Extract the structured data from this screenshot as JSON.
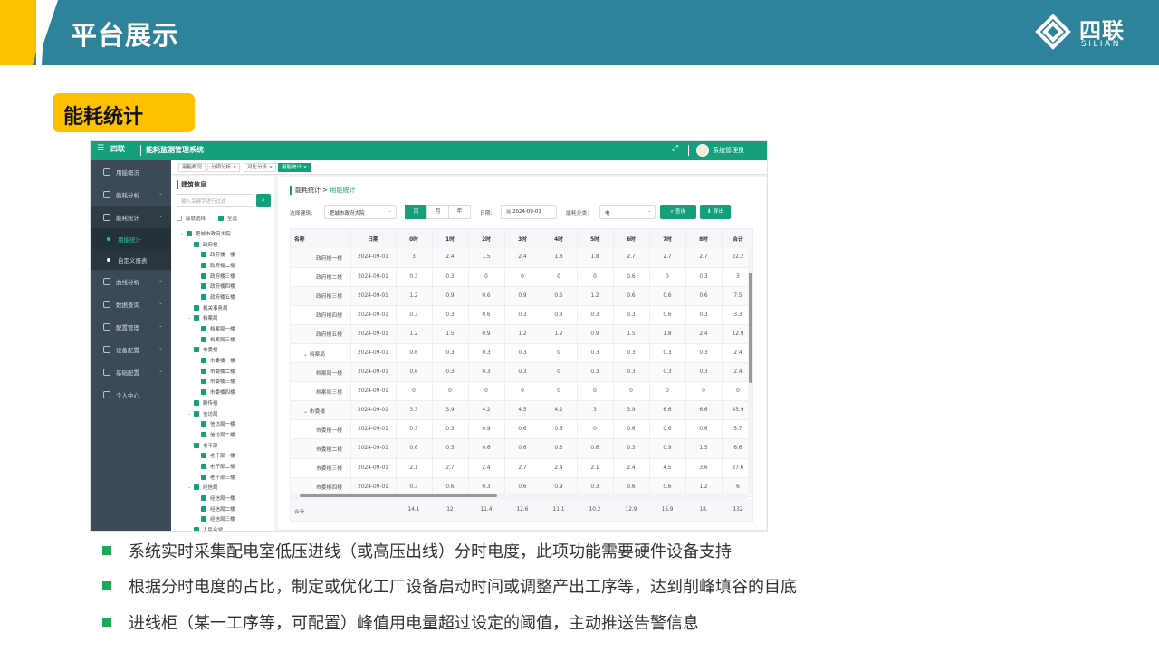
{
  "header": {
    "title": "平台展示",
    "logo_cn": "四联",
    "logo_en": "SILIAN"
  },
  "section_tag": "能耗统计",
  "app": {
    "brand": "四联",
    "system_title": "能耗监测管理系统",
    "user": "系统管理员",
    "sidebar": [
      {
        "label": "用能概况"
      },
      {
        "label": "能耗分析"
      },
      {
        "label": "能耗统计"
      },
      {
        "label": "用能统计",
        "sub": true,
        "active": true
      },
      {
        "label": "自定义报表",
        "sub": true
      },
      {
        "label": "曲线分析"
      },
      {
        "label": "数据查询"
      },
      {
        "label": "配置管理"
      },
      {
        "label": "设备配置"
      },
      {
        "label": "基础配置"
      },
      {
        "label": "个人中心"
      }
    ],
    "tabs": [
      "用能概况",
      "分项分析",
      "对比分析",
      "用能统计"
    ],
    "tree": {
      "title": "建筑信息",
      "search_placeholder": "输入关键字进行过滤",
      "cascade_label": "级联选择",
      "select_all_label": "全选",
      "nodes": [
        {
          "label": "肥城市政府大院",
          "level": 0,
          "arrow": "⌄"
        },
        {
          "label": "政府楼",
          "level": 1,
          "arrow": "⌄"
        },
        {
          "label": "政府楼一楼",
          "level": 2
        },
        {
          "label": "政府楼二楼",
          "level": 2
        },
        {
          "label": "政府楼三楼",
          "level": 2
        },
        {
          "label": "政府楼四楼",
          "level": 2
        },
        {
          "label": "政府楼五楼",
          "level": 2
        },
        {
          "label": "机关事务局",
          "level": 1
        },
        {
          "label": "档案局",
          "level": 1,
          "arrow": "⌄"
        },
        {
          "label": "档案局一楼",
          "level": 2
        },
        {
          "label": "档案局三楼",
          "level": 2
        },
        {
          "label": "市委楼",
          "level": 1,
          "arrow": "⌄"
        },
        {
          "label": "市委楼一楼",
          "level": 2
        },
        {
          "label": "市委楼二楼",
          "level": 2
        },
        {
          "label": "市委楼三楼",
          "level": 2
        },
        {
          "label": "市委楼四楼",
          "level": 2
        },
        {
          "label": "群传楼",
          "level": 1
        },
        {
          "label": "信访局",
          "level": 1,
          "arrow": "⌄"
        },
        {
          "label": "信访局一楼",
          "level": 2
        },
        {
          "label": "信访局二楼",
          "level": 2
        },
        {
          "label": "老干部",
          "level": 1,
          "arrow": "⌄"
        },
        {
          "label": "老干部一楼",
          "level": 2
        },
        {
          "label": "老干部二楼",
          "level": 2
        },
        {
          "label": "老干部三楼",
          "level": 2
        },
        {
          "label": "经信局",
          "level": 1,
          "arrow": "⌄"
        },
        {
          "label": "经信局一楼",
          "level": 2
        },
        {
          "label": "经信局二楼",
          "level": 2
        },
        {
          "label": "经信局三楼",
          "level": 2
        },
        {
          "label": "人民会堂",
          "level": 1
        }
      ]
    },
    "breadcrumb": {
      "parent": "能耗统计",
      "sep": ">",
      "current": "用能统计"
    },
    "filters": {
      "building_label": "选择建筑:",
      "building_value": "肥城市政府大院",
      "periods": [
        "日",
        "月",
        "年"
      ],
      "date_label": "日期:",
      "date_value": "2024-09-01",
      "type_label": "能耗分类:",
      "type_value": "电",
      "query_label": "查询",
      "export_label": "导出"
    },
    "table": {
      "headers": [
        "名称",
        "日期",
        "0时",
        "1时",
        "2时",
        "3时",
        "4时",
        "5时",
        "6时",
        "7时",
        "8时",
        "合计"
      ],
      "rows": [
        [
          "政府楼一楼",
          "2024-09-01",
          "3",
          "2.4",
          "1.5",
          "2.4",
          "1.8",
          "1.8",
          "2.7",
          "2.7",
          "2.7",
          "22.2"
        ],
        [
          "政府楼二楼",
          "2024-09-01",
          "0.3",
          "0.3",
          "0",
          "0",
          "0",
          "0",
          "0.6",
          "0",
          "0.3",
          "3"
        ],
        [
          "政府楼三楼",
          "2024-09-01",
          "1.2",
          "0.9",
          "0.6",
          "0.9",
          "0.6",
          "1.2",
          "0.6",
          "0.6",
          "0.6",
          "7.5"
        ],
        [
          "政府楼四楼",
          "2024-09-01",
          "0.3",
          "0.3",
          "0.6",
          "0.3",
          "0.3",
          "0.3",
          "0.3",
          "0.6",
          "0.3",
          "3.3"
        ],
        [
          "政府楼五楼",
          "2024-09-01",
          "1.2",
          "1.5",
          "0.9",
          "1.2",
          "1.2",
          "0.9",
          "1.5",
          "1.8",
          "2.4",
          "12.9"
        ],
        [
          "档案局",
          "2024-09-01",
          "0.6",
          "0.3",
          "0.3",
          "0.3",
          "0",
          "0.3",
          "0.3",
          "0.3",
          "0.3",
          "2.4"
        ],
        [
          "档案局一楼",
          "2024-09-01",
          "0.6",
          "0.3",
          "0.3",
          "0.3",
          "0",
          "0.3",
          "0.3",
          "0.3",
          "0.3",
          "2.4"
        ],
        [
          "档案局三楼",
          "2024-09-01",
          "0",
          "0",
          "0",
          "0",
          "0",
          "0",
          "0",
          "0",
          "0",
          "0"
        ],
        [
          "市委楼",
          "2024-09-01",
          "3.3",
          "3.9",
          "4.2",
          "4.5",
          "4.2",
          "3",
          "3.9",
          "6.6",
          "6.6",
          "45.9"
        ],
        [
          "市委楼一楼",
          "2024-09-01",
          "0.3",
          "0.3",
          "0.9",
          "0.6",
          "0.6",
          "0",
          "0.6",
          "0.6",
          "0.6",
          "5.7"
        ],
        [
          "市委楼二楼",
          "2024-09-01",
          "0.6",
          "0.3",
          "0.6",
          "0.6",
          "0.3",
          "0.6",
          "0.3",
          "0.9",
          "1.5",
          "6.6"
        ],
        [
          "市委楼三楼",
          "2024-09-01",
          "2.1",
          "2.7",
          "2.4",
          "2.7",
          "2.4",
          "2.1",
          "2.4",
          "4.5",
          "3.6",
          "27.6"
        ],
        [
          "市委楼四楼",
          "2024-09-01",
          "0.3",
          "0.6",
          "0.3",
          "0.6",
          "0.9",
          "0.3",
          "0.6",
          "0.6",
          "1.2",
          "6"
        ]
      ],
      "group_rows": [
        5,
        8
      ],
      "summary": [
        "合计",
        "",
        "14.1",
        "12",
        "11.4",
        "12.6",
        "11.1",
        "10.2",
        "12.9",
        "15.9",
        "18.",
        "132"
      ]
    }
  },
  "bullets": [
    "系统实时采集配电室低压进线（或高压出线）分时电度，此项功能需要硬件设备支持",
    "根据分时电度的占比，制定或优化工厂设备启动时间或调整产出工序等，达到削峰填谷的目底",
    "进线柜（某一工序等，可配置）峰值用电量超过设定的阈值，主动推送告警信息"
  ],
  "colors": {
    "header_band": "#2e839b",
    "accent_yellow": "#ffc000",
    "app_green": "#13a07a",
    "bullet_green": "#1aaa55",
    "sidebar": "#3b4a56"
  }
}
